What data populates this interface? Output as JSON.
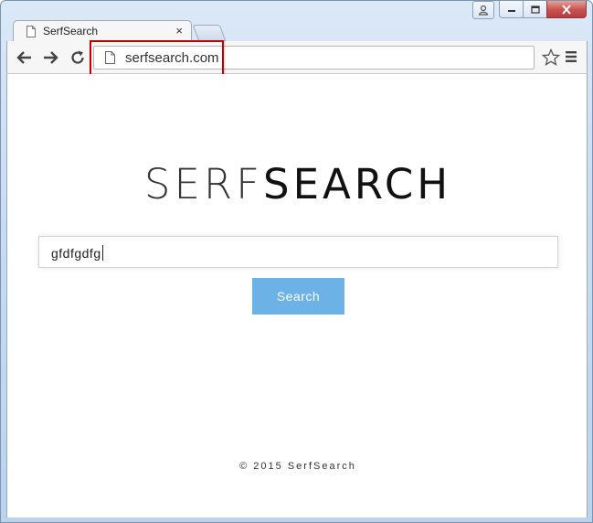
{
  "browser": {
    "tab": {
      "title": "SerfSearch",
      "close_glyph": "×"
    },
    "address_bar": {
      "url": "serfsearch.com"
    },
    "icons": {
      "back": "back-arrow-icon",
      "forward": "forward-arrow-icon",
      "reload": "reload-icon",
      "page": "page-icon",
      "bookmark": "star-icon",
      "menu": "hamburger-menu-icon"
    }
  },
  "page": {
    "logo_serf": "SERF",
    "logo_search": "SEARCH",
    "search_value": "gfdfgdfg",
    "search_button_label": "Search",
    "footer": "© 2015 SerfSearch"
  },
  "colors": {
    "highlight": "#c00000",
    "search_button": "#6cb2e7"
  }
}
